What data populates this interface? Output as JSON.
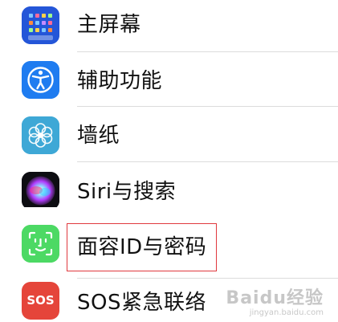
{
  "items": [
    {
      "label": "主屏幕",
      "icon": "home-screen-icon"
    },
    {
      "label": "辅助功能",
      "icon": "accessibility-icon"
    },
    {
      "label": "墙纸",
      "icon": "wallpaper-icon"
    },
    {
      "label": "Siri与搜索",
      "icon": "siri-icon"
    },
    {
      "label": "面容ID与密码",
      "icon": "face-id-icon"
    },
    {
      "label": "SOS紧急联络",
      "icon": "sos-icon",
      "icon_text": "SOS"
    }
  ],
  "colors": {
    "home_screen": "#2d5bdc",
    "accessibility": "#1f7cf0",
    "wallpaper": "#3ea8d6",
    "face_id": "#4cd964",
    "sos": "#e5453a",
    "highlight": "#e0393e"
  },
  "watermark": {
    "text": "Baidu经验",
    "subtext": "jingyan.baidu.com"
  }
}
